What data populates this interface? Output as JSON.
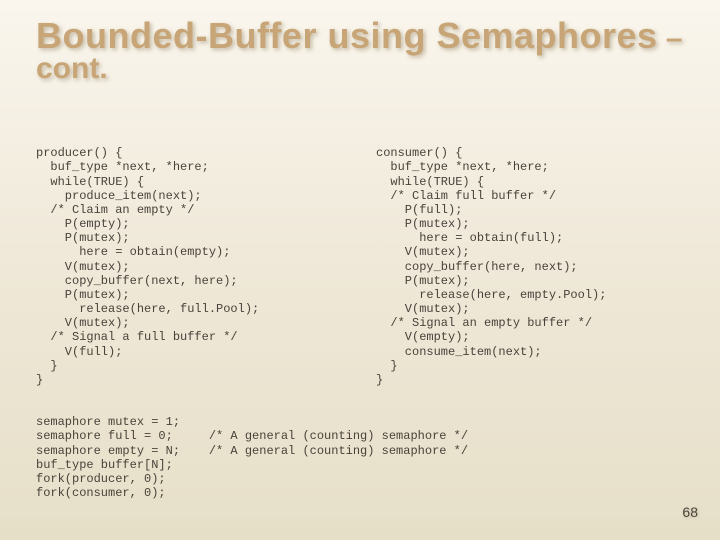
{
  "title": {
    "main": "Bounded-Buffer using Semaphores",
    "sub": " – cont."
  },
  "code": {
    "producer": "producer() {\n  buf_type *next, *here;\n  while(TRUE) {\n    produce_item(next);\n  /* Claim an empty */\n    P(empty);\n    P(mutex);\n      here = obtain(empty);\n    V(mutex);\n    copy_buffer(next, here);\n    P(mutex);\n      release(here, full.Pool);\n    V(mutex);\n  /* Signal a full buffer */\n    V(full);\n  }\n}",
    "consumer": "consumer() {\n  buf_type *next, *here;\n  while(TRUE) {\n  /* Claim full buffer */\n    P(full);\n    P(mutex);\n      here = obtain(full);\n    V(mutex);\n    copy_buffer(here, next);\n    P(mutex);\n      release(here, empty.Pool);\n    V(mutex);\n  /* Signal an empty buffer */\n    V(empty);\n    consume_item(next);\n  }\n}",
    "globals": "semaphore mutex = 1;\nsemaphore full = 0;     /* A general (counting) semaphore */\nsemaphore empty = N;    /* A general (counting) semaphore */\nbuf_type buffer[N];\nfork(producer, 0);\nfork(consumer, 0);"
  },
  "page_number": "68"
}
